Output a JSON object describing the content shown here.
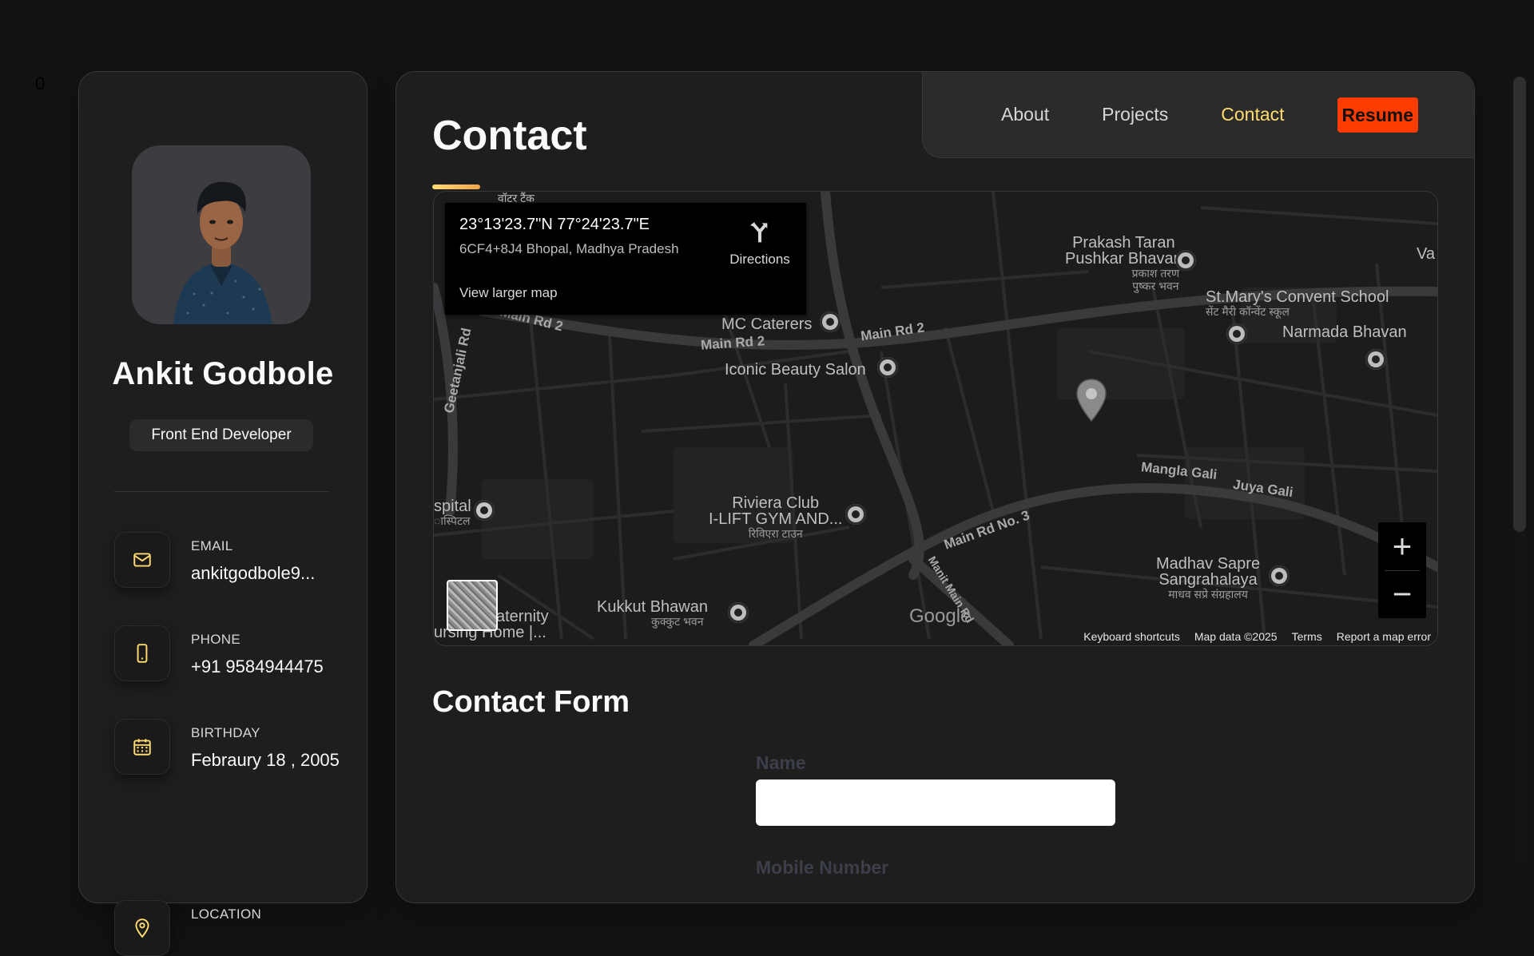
{
  "corner_counter": "0",
  "profile": {
    "name": "Ankit Godbole",
    "title": "Front End Developer",
    "contacts": [
      {
        "label": "EMAIL",
        "value": "ankitgodbole9...",
        "icon": "mail-icon"
      },
      {
        "label": "PHONE",
        "value": "+91 9584944475",
        "icon": "phone-icon"
      },
      {
        "label": "BIRTHDAY",
        "value": "Febraury 18 , 2005",
        "icon": "calendar-icon"
      },
      {
        "label": "LOCATION",
        "value": "",
        "icon": "location-pin-icon"
      }
    ]
  },
  "nav": {
    "about": "About",
    "projects": "Projects",
    "contact": "Contact",
    "resume": "Resume",
    "active": "Contact"
  },
  "page": {
    "title": "Contact"
  },
  "map": {
    "coordinates": "23°13'23.7\"N 77°24'23.7\"E",
    "plus_code": "6CF4+8J4 Bhopal, Madhya Pradesh",
    "directions": "Directions",
    "view_larger": "View larger map",
    "zoom_in": "+",
    "zoom_out": "−",
    "google": "Google",
    "attribution": {
      "keyboard": "Keyboard shortcuts",
      "data": "Map data ©2025",
      "terms": "Terms",
      "report": "Report a map error"
    },
    "places": {
      "prakash": "Prakash Taran\nPushkar Bhavan",
      "prakash_hi": "प्रकाश तरण\nपुष्कर भवन",
      "stmary": "St.Mary's Convent School",
      "stmary_hi": "सेंट मैरी कॉन्वेंट स्कूल",
      "narmada": "Narmada Bhavan",
      "mc_caterers": "MC Caterers",
      "iconic": "Iconic Beauty Salon",
      "riviera": "Riviera Club\nI-LIFT GYM AND...",
      "riviera_hi": "रिविएरा टाउन",
      "madhav": "Madhav Sapre\nSangrahalaya",
      "madhav_hi": "माधव सप्रे संग्रहालय",
      "kukkut": "Kukkut Bhawan",
      "kukkut_hi": "कुक्कुट भवन",
      "hospital": "spital",
      "hospital_hi": "ास्पिटल",
      "maternity": "aternity",
      "nursing": "ursing Home |...",
      "va": "Va",
      "water_tank": "वॉटर टैंक",
      "mangla": "Mangla Gali",
      "juya": "Juya Gali"
    },
    "roads": {
      "main2a": "Main Rd 2",
      "main2b": "Main Rd 2",
      "main2c": "Main Rd 2",
      "main3": "Main Rd No. 3",
      "geetanjali": "Geetanjali Rd",
      "manit": "Manit Main Rd"
    }
  },
  "form": {
    "title": "Contact Form",
    "name_label": "Name",
    "name_value": "",
    "mobile_label": "Mobile Number"
  }
}
